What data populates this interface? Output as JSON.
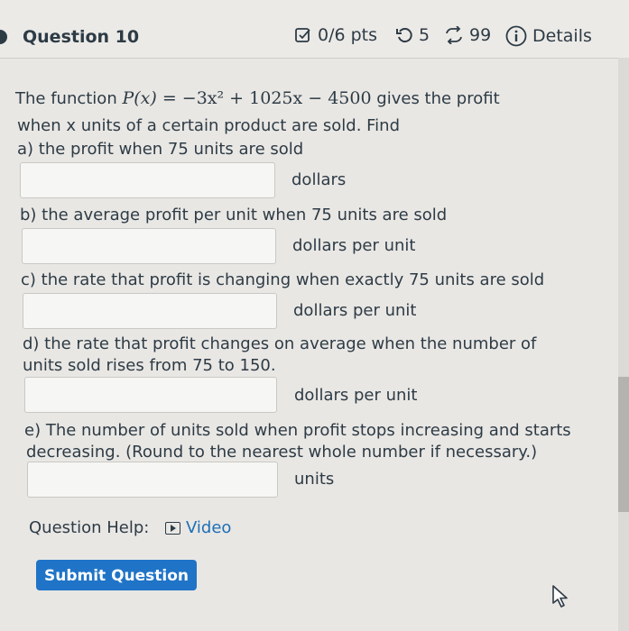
{
  "header": {
    "question_title": "Question 10",
    "points": "0/6 pts",
    "retries": "5",
    "attempts": "99",
    "details_label": "Details"
  },
  "problem": {
    "intro_line1_prefix": "The function",
    "function_lhs": "P(x) = ",
    "function_rhs": "−3x² + 1025x − 4500",
    "intro_line1_suffix": "gives the profit",
    "intro_line2": "when x units of a certain product are sold. Find"
  },
  "parts": [
    {
      "label": "a) the profit when 75 units are sold",
      "unit": "dollars",
      "value": ""
    },
    {
      "label": "b) the average profit per unit when 75 units are sold",
      "unit": "dollars per unit",
      "value": ""
    },
    {
      "label": "c) the rate that profit is changing when exactly 75 units are sold",
      "unit": "dollars per unit",
      "value": ""
    },
    {
      "label_line1": "d) the rate that profit changes on average when the number of",
      "label_line2": "units sold rises from 75 to 150.",
      "unit": "dollars per unit",
      "value": ""
    },
    {
      "label_line1": "e) The number of units sold when profit stops increasing and starts",
      "label_line2": "decreasing. (Round to the nearest whole number if necessary.)",
      "unit": "units",
      "value": ""
    }
  ],
  "help": {
    "label": "Question Help:",
    "video_label": "Video"
  },
  "submit_label": "Submit Question",
  "colors": {
    "link": "#1e6fb5",
    "button": "#1f74c7",
    "text": "#2d3b45"
  }
}
